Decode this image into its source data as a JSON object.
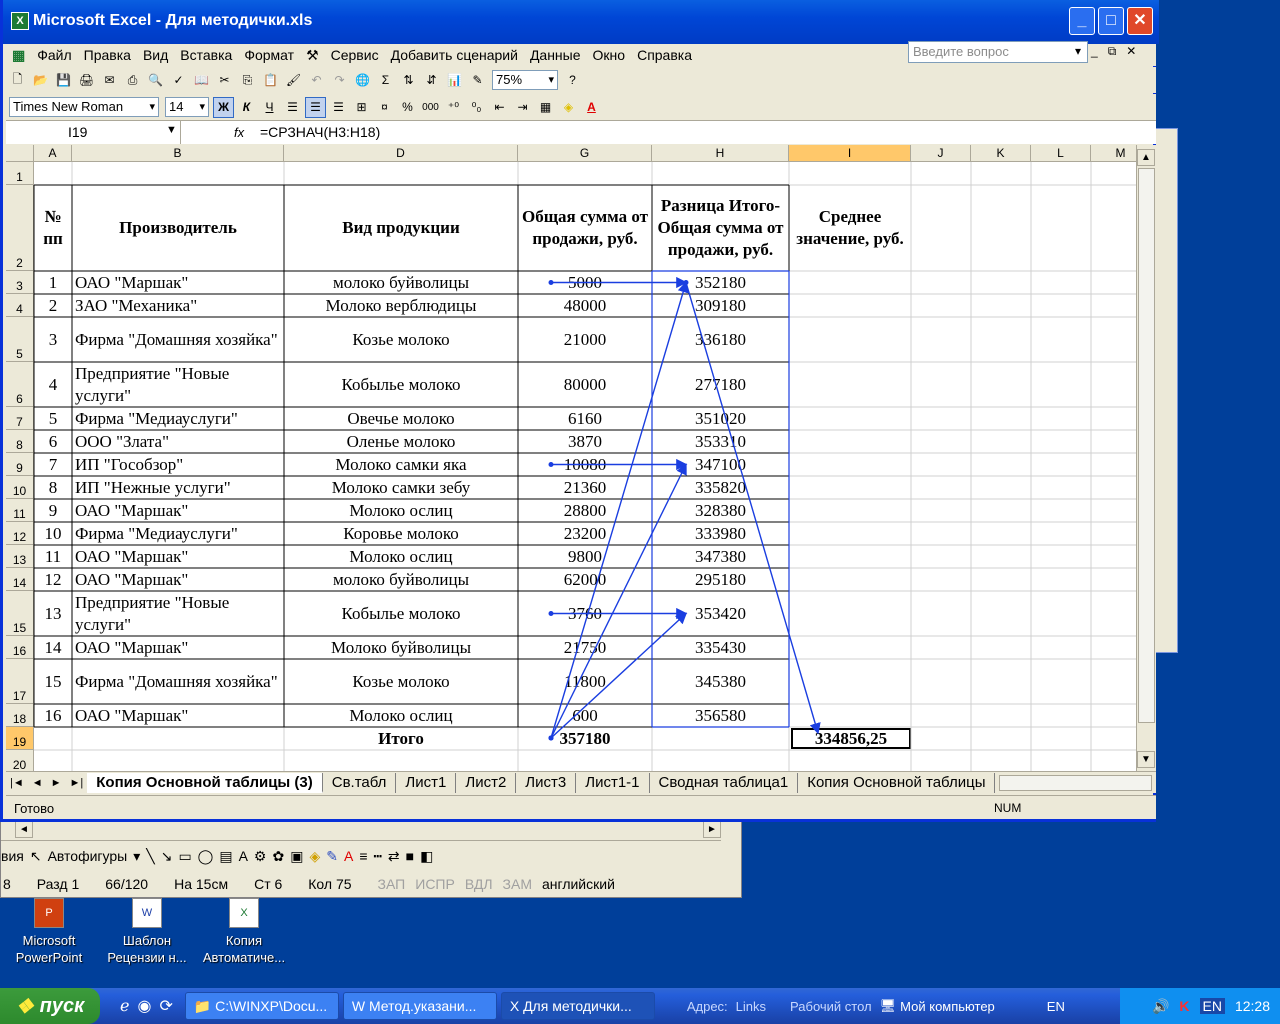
{
  "window": {
    "title": "Microsoft Excel - Для методички.xls",
    "min": "_",
    "max": "□",
    "close": "✕"
  },
  "menu": [
    "Файл",
    "Правка",
    "Вид",
    "Вставка",
    "Формат",
    "Сервис",
    "Добавить сценарий",
    "Данные",
    "Окно",
    "Справка"
  ],
  "help_placeholder": "Введите вопрос",
  "toolbar": {
    "zoom": "75%",
    "font": "Times New Roman",
    "size": "14",
    "bold": "Ж",
    "italic": "К",
    "underline": "Ч",
    "sigma": "Σ",
    "percent": "%",
    "thousands": "000"
  },
  "formula_bar": {
    "name_box": "I19",
    "fx": "fx",
    "formula": "=СРЗНАЧ(H3:H18)"
  },
  "columns": [
    "A",
    "B",
    "D",
    "G",
    "H",
    "I",
    "J",
    "K",
    "L",
    "M"
  ],
  "header": {
    "num": "№ пп",
    "maker": "Производитель",
    "product": "Вид продукции",
    "sum": "Общая сумма от продажи, руб.",
    "diff": "Разница Итого-Общая сумма от продажи, руб.",
    "avg": "Среднее значение, руб."
  },
  "rows": [
    {
      "r": "3",
      "n": "1",
      "maker": "ОАО \"Маршак\"",
      "product": "молоко буйволицы",
      "sum": "5000",
      "diff": "352180"
    },
    {
      "r": "4",
      "n": "2",
      "maker": "ЗАО \"Механика\"",
      "product": "Молоко верблюдицы",
      "sum": "48000",
      "diff": "309180"
    },
    {
      "r": "5",
      "n": "3",
      "maker": "Фирма \"Домашняя хозяйка\"",
      "product": "Козье молоко",
      "sum": "21000",
      "diff": "336180"
    },
    {
      "r": "6",
      "n": "4",
      "maker": "Предприятие \"Новые услуги\"",
      "product": "Кобылье молоко",
      "sum": "80000",
      "diff": "277180"
    },
    {
      "r": "7",
      "n": "5",
      "maker": "Фирма \"Медиауслуги\"",
      "product": "Овечье молоко",
      "sum": "6160",
      "diff": "351020"
    },
    {
      "r": "8",
      "n": "6",
      "maker": "ООО \"Злата\"",
      "product": "Оленье молоко",
      "sum": "3870",
      "diff": "353310"
    },
    {
      "r": "9",
      "n": "7",
      "maker": "ИП \"Гособзор\"",
      "product": "Молоко самки яка",
      "sum": "10080",
      "diff": "347100"
    },
    {
      "r": "10",
      "n": "8",
      "maker": "ИП \"Нежные услуги\"",
      "product": "Молоко самки зебу",
      "sum": "21360",
      "diff": "335820"
    },
    {
      "r": "11",
      "n": "9",
      "maker": "ОАО \"Маршак\"",
      "product": "Молоко ослиц",
      "sum": "28800",
      "diff": "328380"
    },
    {
      "r": "12",
      "n": "10",
      "maker": "Фирма \"Медиауслуги\"",
      "product": "Коровье молоко",
      "sum": "23200",
      "diff": "333980"
    },
    {
      "r": "13",
      "n": "11",
      "maker": "ОАО \"Маршак\"",
      "product": "Молоко ослиц",
      "sum": "9800",
      "diff": "347380"
    },
    {
      "r": "14",
      "n": "12",
      "maker": "ОАО \"Маршак\"",
      "product": "молоко буйволицы",
      "sum": "62000",
      "diff": "295180"
    },
    {
      "r": "15",
      "n": "13",
      "maker": "Предприятие \"Новые услуги\"",
      "product": "Кобылье молоко",
      "sum": "3760",
      "diff": "353420"
    },
    {
      "r": "16",
      "n": "14",
      "maker": "ОАО \"Маршак\"",
      "product": "Молоко буйволицы",
      "sum": "21750",
      "diff": "335430"
    },
    {
      "r": "17",
      "n": "15",
      "maker": "Фирма \"Домашняя хозяйка\"",
      "product": "Козье молоко",
      "sum": "11800",
      "diff": "345380"
    },
    {
      "r": "18",
      "n": "16",
      "maker": "ОАО \"Маршак\"",
      "product": "Молоко ослиц",
      "sum": "600",
      "diff": "356580"
    }
  ],
  "row_labels": {
    "r1": "1",
    "r2": "2",
    "r19": "19",
    "r20": "20"
  },
  "totals": {
    "label": "Итого",
    "sum": "357180",
    "avg": "334856,25"
  },
  "sheets": [
    "Копия Основной таблицы (3)",
    "Св.табл",
    "Лист1",
    "Лист2",
    "Лист3",
    "Лист1-1",
    "Сводная таблица1",
    "Копия Основной таблицы"
  ],
  "status": {
    "ready": "Готово",
    "num": "NUM"
  },
  "word": {
    "menu_left": "вия",
    "autoshapes": "Автофигуры",
    "status": [
      "8",
      "Разд 1",
      "66/120",
      "На 15см",
      "Ст 6",
      "Кол 75"
    ],
    "dim": [
      "ЗАП",
      "ИСПР",
      "ВДЛ",
      "ЗАМ"
    ],
    "lang": "английский"
  },
  "desktop_icons": [
    {
      "line1": "Microsoft",
      "line2": "PowerPoint",
      "icon": "ppt-icon"
    },
    {
      "line1": "Шаблон",
      "line2": "Рецензии н...",
      "icon": "word-doc-icon"
    },
    {
      "line1": "Копия",
      "line2": "Автоматиче...",
      "icon": "excel-doc-icon"
    }
  ],
  "taskbar": {
    "start": "пуск",
    "tasks": [
      "C:\\WINXP\\Docu...",
      "Метод.указани...",
      "Для методички..."
    ],
    "address": "Адрес:",
    "links": "Links",
    "desktop": "Рабочий стол",
    "mycomp": "Мой компьютер",
    "lang": "EN",
    "tray_lang": "EN",
    "clock": "12:28"
  },
  "colors": {
    "arrow": "#1a3ee0",
    "selected_header": "#ffc86a",
    "title_bar": "#0054e3"
  }
}
